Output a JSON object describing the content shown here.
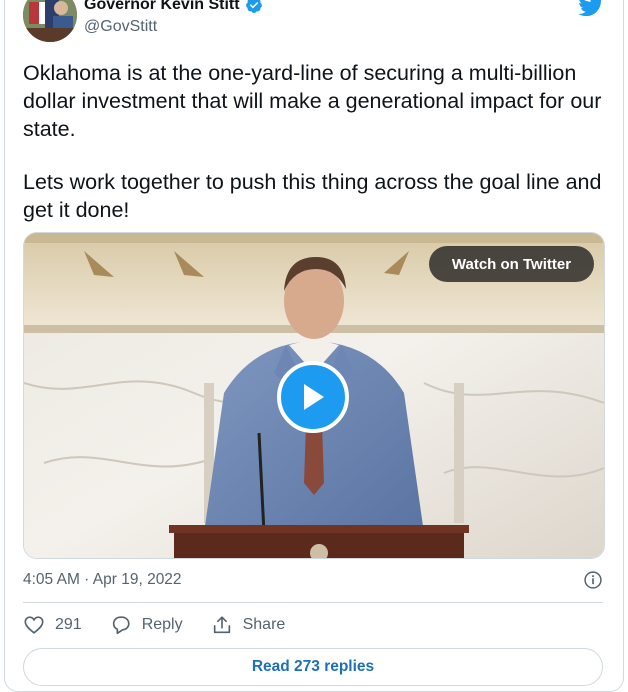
{
  "author": {
    "name": "Governor Kevin Stitt",
    "handle": "@GovStitt",
    "verified": true
  },
  "tweet": {
    "paragraphs": [
      "Oklahoma is at the one-yard-line of securing a multi-billion dollar investment that will make a generational impact for our state.",
      "Lets work together to push this thing across the goal line and get it done!"
    ]
  },
  "media": {
    "watch_label": "Watch on Twitter",
    "play_icon": "play-icon"
  },
  "meta": {
    "timestamp": "4:05 AM · Apr 19, 2022",
    "info_icon": "info-icon"
  },
  "actions": {
    "likes": "291",
    "reply_label": "Reply",
    "share_label": "Share"
  },
  "replies": {
    "label": "Read 273 replies"
  },
  "colors": {
    "twitter_blue": "#1d9bf0",
    "link_blue": "#1d70b8",
    "secondary_text": "#536471",
    "border": "#cfd9de"
  }
}
